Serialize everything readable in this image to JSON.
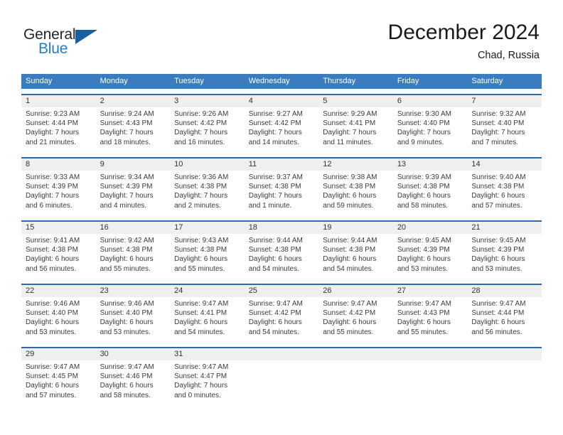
{
  "brand": {
    "name_part1": "General",
    "name_part2": "Blue"
  },
  "header": {
    "month_title": "December 2024",
    "location": "Chad, Russia"
  },
  "colors": {
    "header_blue": "#3a7cbf",
    "rule_blue": "#2c6aad",
    "number_band": "#efefef",
    "logo_blue": "#1d7fc7",
    "logo_triangle": "#15619f"
  },
  "day_headers": [
    "Sunday",
    "Monday",
    "Tuesday",
    "Wednesday",
    "Thursday",
    "Friday",
    "Saturday"
  ],
  "weeks": [
    {
      "days": [
        {
          "num": "1",
          "l1": "Sunrise: 9:23 AM",
          "l2": "Sunset: 4:44 PM",
          "l3": "Daylight: 7 hours",
          "l4": "and 21 minutes."
        },
        {
          "num": "2",
          "l1": "Sunrise: 9:24 AM",
          "l2": "Sunset: 4:43 PM",
          "l3": "Daylight: 7 hours",
          "l4": "and 18 minutes."
        },
        {
          "num": "3",
          "l1": "Sunrise: 9:26 AM",
          "l2": "Sunset: 4:42 PM",
          "l3": "Daylight: 7 hours",
          "l4": "and 16 minutes."
        },
        {
          "num": "4",
          "l1": "Sunrise: 9:27 AM",
          "l2": "Sunset: 4:42 PM",
          "l3": "Daylight: 7 hours",
          "l4": "and 14 minutes."
        },
        {
          "num": "5",
          "l1": "Sunrise: 9:29 AM",
          "l2": "Sunset: 4:41 PM",
          "l3": "Daylight: 7 hours",
          "l4": "and 11 minutes."
        },
        {
          "num": "6",
          "l1": "Sunrise: 9:30 AM",
          "l2": "Sunset: 4:40 PM",
          "l3": "Daylight: 7 hours",
          "l4": "and 9 minutes."
        },
        {
          "num": "7",
          "l1": "Sunrise: 9:32 AM",
          "l2": "Sunset: 4:40 PM",
          "l3": "Daylight: 7 hours",
          "l4": "and 7 minutes."
        }
      ]
    },
    {
      "days": [
        {
          "num": "8",
          "l1": "Sunrise: 9:33 AM",
          "l2": "Sunset: 4:39 PM",
          "l3": "Daylight: 7 hours",
          "l4": "and 6 minutes."
        },
        {
          "num": "9",
          "l1": "Sunrise: 9:34 AM",
          "l2": "Sunset: 4:39 PM",
          "l3": "Daylight: 7 hours",
          "l4": "and 4 minutes."
        },
        {
          "num": "10",
          "l1": "Sunrise: 9:36 AM",
          "l2": "Sunset: 4:38 PM",
          "l3": "Daylight: 7 hours",
          "l4": "and 2 minutes."
        },
        {
          "num": "11",
          "l1": "Sunrise: 9:37 AM",
          "l2": "Sunset: 4:38 PM",
          "l3": "Daylight: 7 hours",
          "l4": "and 1 minute."
        },
        {
          "num": "12",
          "l1": "Sunrise: 9:38 AM",
          "l2": "Sunset: 4:38 PM",
          "l3": "Daylight: 6 hours",
          "l4": "and 59 minutes."
        },
        {
          "num": "13",
          "l1": "Sunrise: 9:39 AM",
          "l2": "Sunset: 4:38 PM",
          "l3": "Daylight: 6 hours",
          "l4": "and 58 minutes."
        },
        {
          "num": "14",
          "l1": "Sunrise: 9:40 AM",
          "l2": "Sunset: 4:38 PM",
          "l3": "Daylight: 6 hours",
          "l4": "and 57 minutes."
        }
      ]
    },
    {
      "days": [
        {
          "num": "15",
          "l1": "Sunrise: 9:41 AM",
          "l2": "Sunset: 4:38 PM",
          "l3": "Daylight: 6 hours",
          "l4": "and 56 minutes."
        },
        {
          "num": "16",
          "l1": "Sunrise: 9:42 AM",
          "l2": "Sunset: 4:38 PM",
          "l3": "Daylight: 6 hours",
          "l4": "and 55 minutes."
        },
        {
          "num": "17",
          "l1": "Sunrise: 9:43 AM",
          "l2": "Sunset: 4:38 PM",
          "l3": "Daylight: 6 hours",
          "l4": "and 55 minutes."
        },
        {
          "num": "18",
          "l1": "Sunrise: 9:44 AM",
          "l2": "Sunset: 4:38 PM",
          "l3": "Daylight: 6 hours",
          "l4": "and 54 minutes."
        },
        {
          "num": "19",
          "l1": "Sunrise: 9:44 AM",
          "l2": "Sunset: 4:38 PM",
          "l3": "Daylight: 6 hours",
          "l4": "and 54 minutes."
        },
        {
          "num": "20",
          "l1": "Sunrise: 9:45 AM",
          "l2": "Sunset: 4:39 PM",
          "l3": "Daylight: 6 hours",
          "l4": "and 53 minutes."
        },
        {
          "num": "21",
          "l1": "Sunrise: 9:45 AM",
          "l2": "Sunset: 4:39 PM",
          "l3": "Daylight: 6 hours",
          "l4": "and 53 minutes."
        }
      ]
    },
    {
      "days": [
        {
          "num": "22",
          "l1": "Sunrise: 9:46 AM",
          "l2": "Sunset: 4:40 PM",
          "l3": "Daylight: 6 hours",
          "l4": "and 53 minutes."
        },
        {
          "num": "23",
          "l1": "Sunrise: 9:46 AM",
          "l2": "Sunset: 4:40 PM",
          "l3": "Daylight: 6 hours",
          "l4": "and 53 minutes."
        },
        {
          "num": "24",
          "l1": "Sunrise: 9:47 AM",
          "l2": "Sunset: 4:41 PM",
          "l3": "Daylight: 6 hours",
          "l4": "and 54 minutes."
        },
        {
          "num": "25",
          "l1": "Sunrise: 9:47 AM",
          "l2": "Sunset: 4:42 PM",
          "l3": "Daylight: 6 hours",
          "l4": "and 54 minutes."
        },
        {
          "num": "26",
          "l1": "Sunrise: 9:47 AM",
          "l2": "Sunset: 4:42 PM",
          "l3": "Daylight: 6 hours",
          "l4": "and 55 minutes."
        },
        {
          "num": "27",
          "l1": "Sunrise: 9:47 AM",
          "l2": "Sunset: 4:43 PM",
          "l3": "Daylight: 6 hours",
          "l4": "and 55 minutes."
        },
        {
          "num": "28",
          "l1": "Sunrise: 9:47 AM",
          "l2": "Sunset: 4:44 PM",
          "l3": "Daylight: 6 hours",
          "l4": "and 56 minutes."
        }
      ]
    },
    {
      "days": [
        {
          "num": "29",
          "l1": "Sunrise: 9:47 AM",
          "l2": "Sunset: 4:45 PM",
          "l3": "Daylight: 6 hours",
          "l4": "and 57 minutes."
        },
        {
          "num": "30",
          "l1": "Sunrise: 9:47 AM",
          "l2": "Sunset: 4:46 PM",
          "l3": "Daylight: 6 hours",
          "l4": "and 58 minutes."
        },
        {
          "num": "31",
          "l1": "Sunrise: 9:47 AM",
          "l2": "Sunset: 4:47 PM",
          "l3": "Daylight: 7 hours",
          "l4": "and 0 minutes."
        },
        {
          "num": "",
          "l1": "",
          "l2": "",
          "l3": "",
          "l4": ""
        },
        {
          "num": "",
          "l1": "",
          "l2": "",
          "l3": "",
          "l4": ""
        },
        {
          "num": "",
          "l1": "",
          "l2": "",
          "l3": "",
          "l4": ""
        },
        {
          "num": "",
          "l1": "",
          "l2": "",
          "l3": "",
          "l4": ""
        }
      ]
    }
  ]
}
